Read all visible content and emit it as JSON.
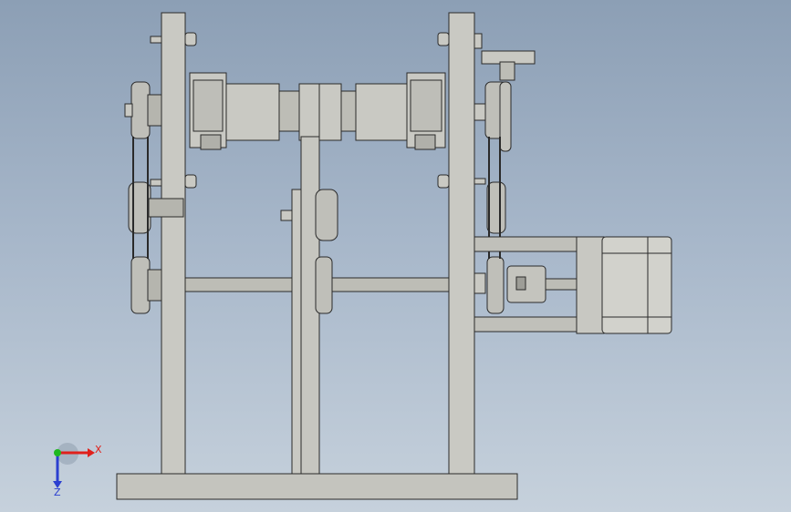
{
  "view": {
    "background_top": "#8c9fb5",
    "background_bottom": "#c6d1dc",
    "part_fill": "#c9c9c3",
    "part_stroke": "#2a2a2a",
    "shade": "#a8a8a2",
    "motor_fill": "#d2d2cc"
  },
  "triad": {
    "x_label": "X",
    "z_label": "Z",
    "x_color": "#e0201b",
    "y_color": "#1fb81f",
    "z_color": "#2b3fd0"
  }
}
